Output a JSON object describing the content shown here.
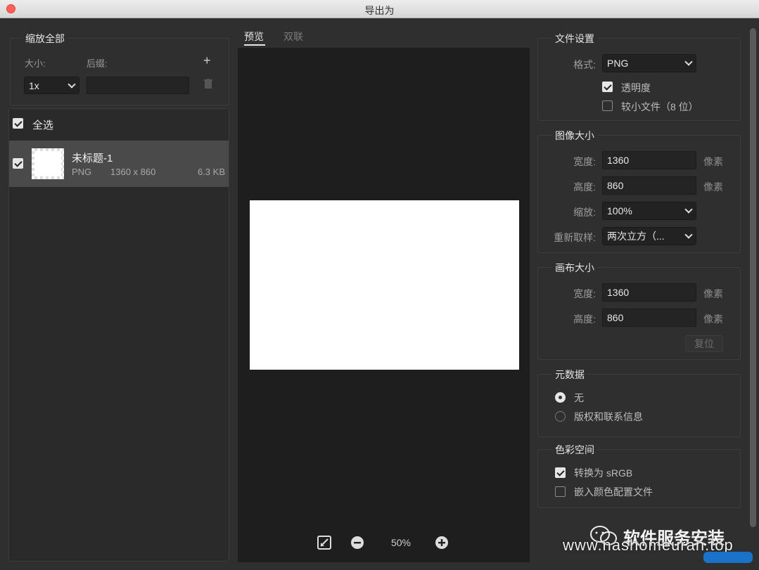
{
  "window": {
    "title": "导出为"
  },
  "scale_all": {
    "title": "缩放全部",
    "size_label": "大小:",
    "suffix_label": "后缀:",
    "size_value": "1x",
    "suffix_value": "",
    "add_icon": "plus-icon",
    "delete_icon": "trash-icon"
  },
  "assets": {
    "select_all_label": "全选",
    "select_all_checked": true,
    "items": [
      {
        "name": "未标题-1",
        "format": "PNG",
        "dimensions": "1360 x 860",
        "size": "6.3 KB",
        "checked": true
      }
    ]
  },
  "preview": {
    "tabs": [
      {
        "label": "预览",
        "active": true
      },
      {
        "label": "双联",
        "active": false
      }
    ],
    "zoom": "50%"
  },
  "file_settings": {
    "title": "文件设置",
    "format_label": "格式:",
    "format_value": "PNG",
    "transparency_label": "透明度",
    "transparency_checked": true,
    "smaller_file_label": "较小文件（8 位）",
    "smaller_file_checked": false
  },
  "image_size": {
    "title": "图像大小",
    "width_label": "宽度:",
    "width_value": "1360",
    "height_label": "高度:",
    "height_value": "860",
    "unit": "像素",
    "scale_label": "缩放:",
    "scale_value": "100%",
    "resample_label": "重新取样:",
    "resample_value": "两次立方（..."
  },
  "canvas_size": {
    "title": "画布大小",
    "width_label": "宽度:",
    "width_value": "1360",
    "height_label": "高度:",
    "height_value": "860",
    "unit": "像素",
    "reset_label": "复位"
  },
  "metadata": {
    "title": "元数据",
    "options": [
      {
        "label": "无",
        "selected": true
      },
      {
        "label": "版权和联系信息",
        "selected": false
      }
    ]
  },
  "color_space": {
    "title": "色彩空间",
    "convert_label": "转换为 sRGB",
    "convert_checked": true,
    "embed_label": "嵌入颜色配置文件",
    "embed_checked": false
  },
  "watermark": {
    "brand": "软件服务安装",
    "url": "www.nashomeuran.top"
  },
  "colors": {
    "window_bg": "#2f2f2f",
    "preview_bg": "#1e1e1e",
    "selected_row": "#4a4a4a",
    "close_button": "#fe5f57"
  }
}
